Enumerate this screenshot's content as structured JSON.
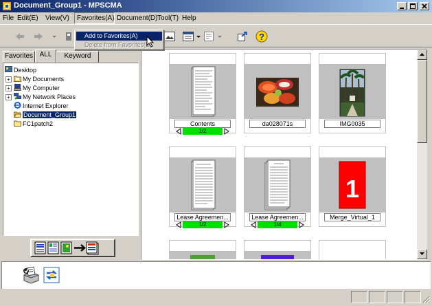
{
  "window": {
    "title": "Document_Group1 - MPSCMA",
    "app_icon": "mpscma-app-icon",
    "buttons": [
      "minimize-icon",
      "maximize-icon",
      "close-icon"
    ]
  },
  "menu": {
    "items": [
      "File",
      "Edit(E)",
      "View(V)",
      "Favorites(A)",
      "Document(D)",
      "Tool(T)",
      "Help"
    ],
    "open_index": 3
  },
  "dropdown": {
    "items": [
      {
        "label": "Add to Favorites(A)",
        "state": "highlighted"
      },
      {
        "label": "Delete from Favorites(D)",
        "state": "disabled"
      }
    ]
  },
  "toolbar": {
    "icons": [
      "back-arrow-icon",
      "forward-arrow-icon",
      "dropdown-arrow-icon",
      "tool-icon",
      "image-view-icon",
      "list-view-icon",
      "document-view-icon",
      "export-icon",
      "help-icon"
    ]
  },
  "left_pane": {
    "tabs": [
      "Favorites",
      "ALL",
      "Keyword"
    ],
    "active_tab": 1,
    "tree": [
      {
        "label": "Desktop",
        "level": 0,
        "icon": "desktop-icon"
      },
      {
        "label": "My Documents",
        "level": 1,
        "icon": "my-documents-icon",
        "expandable": true
      },
      {
        "label": "My Computer",
        "level": 1,
        "icon": "my-computer-icon",
        "expandable": true
      },
      {
        "label": "My Network Places",
        "level": 1,
        "icon": "network-places-icon",
        "expandable": true
      },
      {
        "label": "Internet Explorer",
        "level": 1,
        "icon": "internet-explorer-icon"
      },
      {
        "label": "Document_Group1",
        "level": 1,
        "icon": "folder-open-icon",
        "selected": true
      },
      {
        "label": "FC1patch2",
        "level": 1,
        "icon": "folder-icon"
      }
    ],
    "action_button_icon": "document-convert-icon"
  },
  "thumbnails": [
    {
      "name": "Contents",
      "image": "document-page-icon",
      "page": "1/2"
    },
    {
      "name": "da028071s",
      "image": "fruit-photo",
      "page": null
    },
    {
      "name": "IMG0035",
      "image": "palm-photo",
      "page": null
    },
    {
      "name": "Lease Agreemen...",
      "image": "document-page-icon",
      "page": "1/2"
    },
    {
      "name": "Lease Agreemen...",
      "image": "document-page-icon",
      "page": "1/4"
    },
    {
      "name": "Merge_Virtual_1",
      "image": "red-number-icon",
      "image_text": "1",
      "page": null
    }
  ],
  "bottom_bar": {
    "icons": [
      "print-icon",
      "refresh-link-icon"
    ]
  },
  "colors": {
    "titlebar": "#0a246a",
    "highlight": "#0a246a",
    "pager": "#00e000",
    "merge": "#ff0000"
  }
}
